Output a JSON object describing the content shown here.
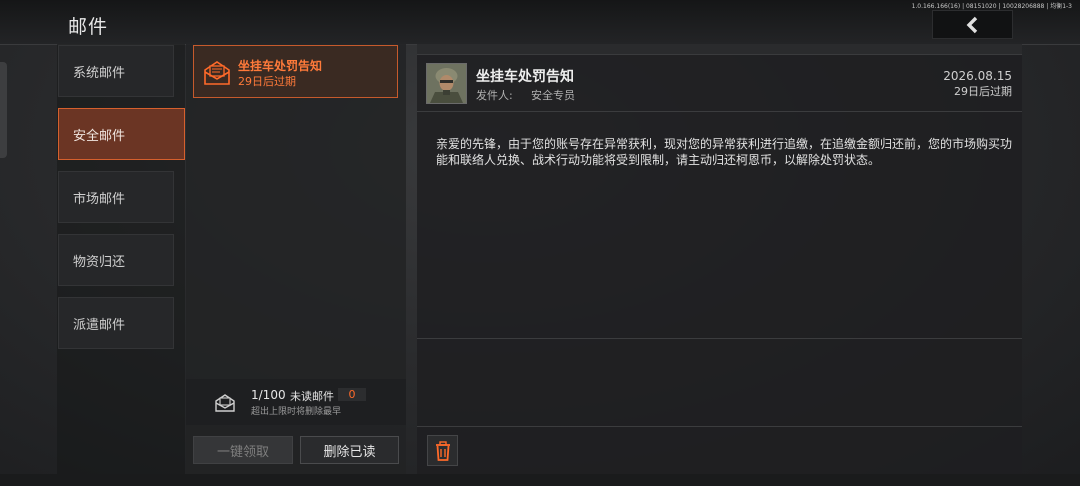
{
  "build_info": "1.0.166.166(16) | 08151020 | 10028206888 | 均衡1-3",
  "header": {
    "title": "邮件"
  },
  "categories": [
    {
      "label": "系统邮件",
      "active": false
    },
    {
      "label": "安全邮件",
      "active": true
    },
    {
      "label": "市场邮件",
      "active": false
    },
    {
      "label": "物资归还",
      "active": false
    },
    {
      "label": "派遣邮件",
      "active": false
    }
  ],
  "mail_list": {
    "items": [
      {
        "title": "坐挂车处罚告知",
        "expire": "29日后过期"
      }
    ],
    "count": "1/100",
    "unread_label": "未读邮件",
    "unread_count": "0",
    "hint": "超出上限时将删除最早"
  },
  "buttons": {
    "collect_all": "一键领取",
    "delete_read": "删除已读"
  },
  "detail": {
    "title": "坐挂车处罚告知",
    "sender_label": "发件人:",
    "sender": "安全专员",
    "date": "2026.08.15",
    "expire": "29日后过期",
    "body": "亲爱的先锋，由于您的账号存在异常获利，现对您的异常获利进行追缴，在追缴金额归还前，您的市场购买功能和联络人兑换、战术行动功能将受到限制，请主动归还柯恩币，以解除处罚状态。"
  },
  "colors": {
    "accent": "#ff6a2a",
    "active_tab_bg": "#6b3524",
    "active_border": "#d6602d"
  },
  "icons": [
    "back-chevron-icon",
    "envelope-icon",
    "mail-tray-icon",
    "trash-icon",
    "avatar"
  ]
}
